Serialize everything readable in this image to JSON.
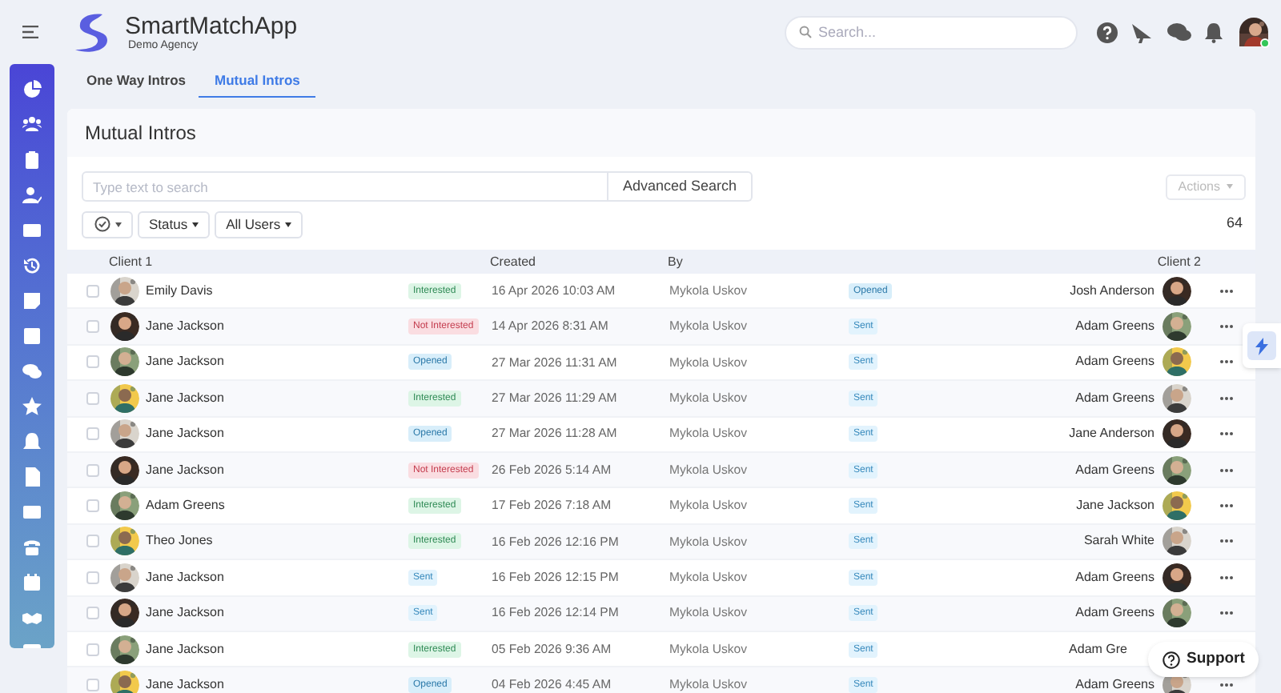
{
  "app": {
    "name": "SmartMatchApp",
    "agency": "Demo Agency"
  },
  "search": {
    "placeholder": "Search..."
  },
  "tabs": [
    {
      "label": "One Way Intros",
      "selected": false
    },
    {
      "label": "Mutual Intros",
      "selected": true
    }
  ],
  "card": {
    "title": "Mutual Intros",
    "search_placeholder": "Type text to search",
    "advanced_search": "Advanced Search",
    "actions": "Actions",
    "filters": [
      "Status",
      "All Users"
    ],
    "count": "64"
  },
  "table": {
    "columns": [
      "Client 1",
      "Created",
      "By",
      "Client 2"
    ],
    "rows": [
      {
        "checked": false,
        "client1": "Emily Davis",
        "status1": {
          "kind": "interested",
          "label": "Interested"
        },
        "created": "16 Apr 2026 10:03 AM",
        "by": "Mykola Uskov",
        "status2": {
          "kind": "opened",
          "label": "Opened"
        },
        "client2": "Josh Anderson",
        "client2_avatar": true
      },
      {
        "checked": false,
        "client1": "Jane Jackson",
        "status1": {
          "kind": "not_interested",
          "label": "Not Interested"
        },
        "created": "14 Apr 2026 8:31 AM",
        "by": "Mykola Uskov",
        "status2": {
          "kind": "sent",
          "label": "Sent"
        },
        "client2": "Adam Greens",
        "client2_avatar": true
      },
      {
        "checked": false,
        "client1": "Jane Jackson",
        "status1": {
          "kind": "opened",
          "label": "Opened"
        },
        "created": "27 Mar 2026 11:31 AM",
        "by": "Mykola Uskov",
        "status2": {
          "kind": "sent",
          "label": "Sent"
        },
        "client2": "Adam Greens",
        "client2_avatar": true
      },
      {
        "checked": false,
        "client1": "Jane Jackson",
        "status1": {
          "kind": "interested",
          "label": "Interested"
        },
        "created": "27 Mar 2026 11:29 AM",
        "by": "Mykola Uskov",
        "status2": {
          "kind": "sent",
          "label": "Sent"
        },
        "client2": "Adam Greens",
        "client2_avatar": true
      },
      {
        "checked": false,
        "client1": "Jane Jackson",
        "status1": {
          "kind": "opened",
          "label": "Opened"
        },
        "created": "27 Mar 2026 11:28 AM",
        "by": "Mykola Uskov",
        "status2": {
          "kind": "sent",
          "label": "Sent"
        },
        "client2": "Jane Anderson",
        "client2_avatar": true
      },
      {
        "checked": false,
        "client1": "Jane Jackson",
        "status1": {
          "kind": "not_interested",
          "label": "Not Interested"
        },
        "created": "26 Feb 2026 5:14 AM",
        "by": "Mykola Uskov",
        "status2": {
          "kind": "sent",
          "label": "Sent"
        },
        "client2": "Adam Greens",
        "client2_avatar": true
      },
      {
        "checked": false,
        "client1": "Adam Greens",
        "status1": {
          "kind": "interested",
          "label": "Interested"
        },
        "created": "17 Feb 2026 7:18 AM",
        "by": "Mykola Uskov",
        "status2": {
          "kind": "sent",
          "label": "Sent"
        },
        "client2": "Jane Jackson",
        "client2_avatar": true
      },
      {
        "checked": false,
        "client1": "Theo Jones",
        "status1": {
          "kind": "interested",
          "label": "Interested"
        },
        "created": "16 Feb 2026 12:16 PM",
        "by": "Mykola Uskov",
        "status2": {
          "kind": "sent",
          "label": "Sent"
        },
        "client2": "Sarah White",
        "client2_avatar": true
      },
      {
        "checked": false,
        "client1": "Jane Jackson",
        "status1": {
          "kind": "sent",
          "label": "Sent"
        },
        "created": "16 Feb 2026 12:15 PM",
        "by": "Mykola Uskov",
        "status2": {
          "kind": "sent",
          "label": "Sent"
        },
        "client2": "Adam Greens",
        "client2_avatar": true
      },
      {
        "checked": false,
        "client1": "Jane Jackson",
        "status1": {
          "kind": "sent",
          "label": "Sent"
        },
        "created": "16 Feb 2026 12:14 PM",
        "by": "Mykola Uskov",
        "status2": {
          "kind": "sent",
          "label": "Sent"
        },
        "client2": "Adam Greens",
        "client2_avatar": true
      },
      {
        "checked": false,
        "client1": "Jane Jackson",
        "status1": {
          "kind": "interested",
          "label": "Interested"
        },
        "created": "05 Feb 2026 9:36 AM",
        "by": "Mykola Uskov",
        "status2": {
          "kind": "sent",
          "label": "Sent"
        },
        "client2": "Adam Gre",
        "client2_avatar": false
      },
      {
        "checked": false,
        "client1": "Jane Jackson",
        "status1": {
          "kind": "opened",
          "label": "Opened"
        },
        "created": "04 Feb 2026 4:45 AM",
        "by": "Mykola Uskov",
        "status2": {
          "kind": "sent",
          "label": "Sent"
        },
        "client2": "Adam Greens",
        "client2_avatar": true
      }
    ]
  },
  "support": {
    "label": "Support"
  }
}
